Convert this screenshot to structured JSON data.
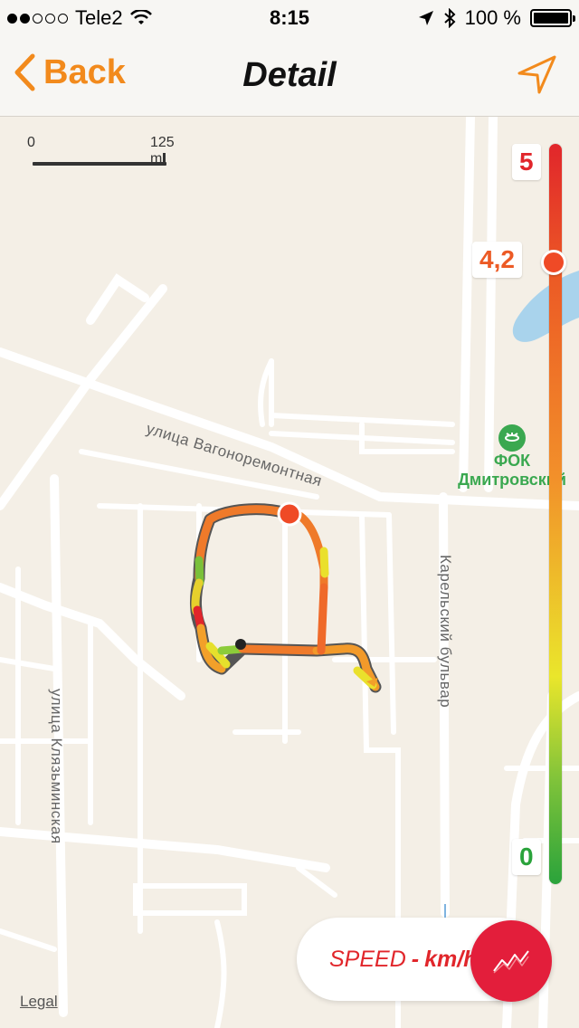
{
  "status_bar": {
    "carrier": "Tele2",
    "time": "8:15",
    "battery": "100 %",
    "signal_bars": 2
  },
  "nav": {
    "back_label": "Back",
    "title": "Detail",
    "icons": {
      "back": "chevron-left-icon",
      "locate": "location-arrow-icon"
    }
  },
  "map": {
    "scale_start": "0",
    "scale_end": "125 m",
    "streets": {
      "vagonoremontnaya": "улица Вагоноремонтная",
      "karelsky": "Карельский бульвар",
      "klyazminskaya": "улица Клязьминская"
    },
    "poi": {
      "line1": "ФОК",
      "line2": "Дмитровский",
      "icon": "sports-complex-icon",
      "color": "#3aa850"
    },
    "legal": "Legal"
  },
  "speed_scale": {
    "max": "5",
    "current": "4,2",
    "min": "0",
    "current_fraction": 0.84,
    "colors": {
      "high": "#e1262b",
      "mid": "#f2902a",
      "low": "#2aa33b"
    }
  },
  "metric": {
    "label": "SPEED",
    "separator": "-",
    "unit": "km/h",
    "chart_icon": "line-chart-icon",
    "accent": "#e31e3b"
  }
}
